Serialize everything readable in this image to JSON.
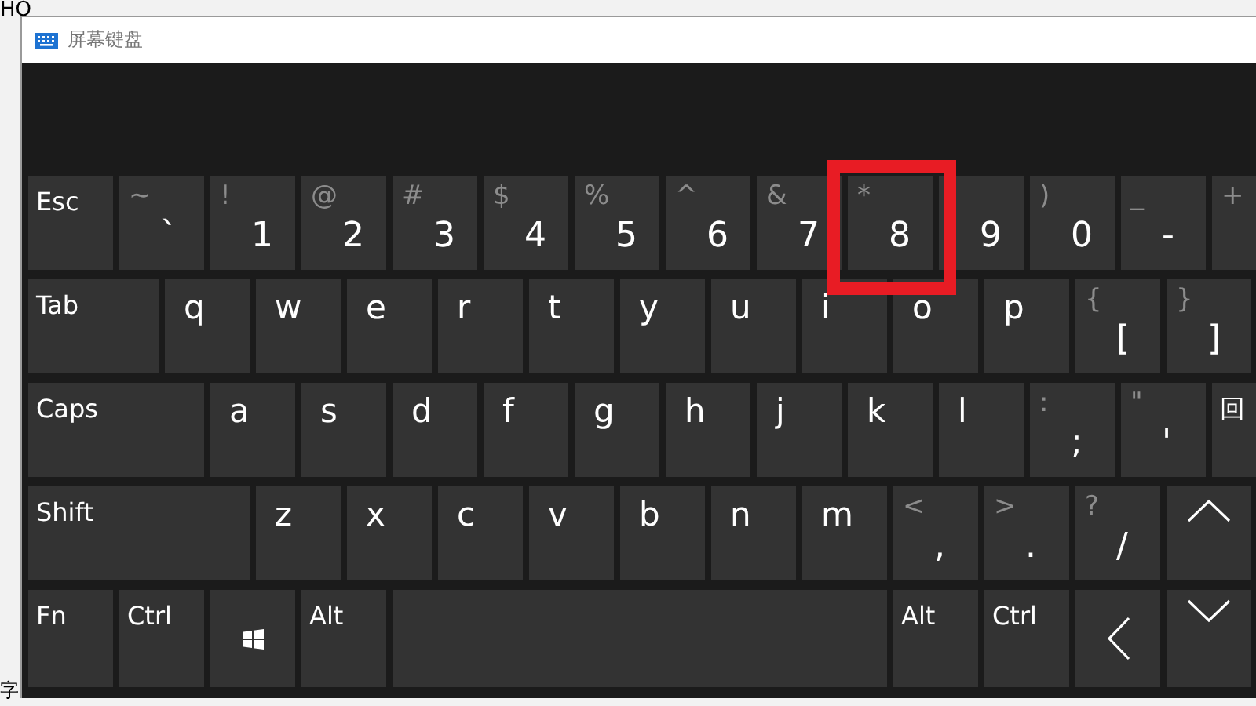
{
  "background": {
    "top_text": "HO",
    "bottom_text": "字"
  },
  "window": {
    "title": "屏幕键盘"
  },
  "rows": [
    {
      "keys": [
        {
          "kind": "label",
          "label": "Esc"
        },
        {
          "kind": "dual",
          "shift": "~",
          "main": "`"
        },
        {
          "kind": "dual",
          "shift": "!",
          "main": "1"
        },
        {
          "kind": "dual",
          "shift": "@",
          "main": "2"
        },
        {
          "kind": "dual",
          "shift": "#",
          "main": "3"
        },
        {
          "kind": "dual",
          "shift": "$",
          "main": "4"
        },
        {
          "kind": "dual",
          "shift": "%",
          "main": "5"
        },
        {
          "kind": "dual",
          "shift": "^",
          "main": "6"
        },
        {
          "kind": "dual",
          "shift": "&",
          "main": "7"
        },
        {
          "kind": "dual",
          "shift": "*",
          "main": "8",
          "highlighted": true
        },
        {
          "kind": "dual",
          "main": "9"
        },
        {
          "kind": "dual",
          "shift": ")",
          "main": "0"
        },
        {
          "kind": "dual",
          "shift": "_",
          "main": "-"
        },
        {
          "kind": "dual",
          "shift": "+"
        }
      ]
    },
    {
      "keys": [
        {
          "kind": "label",
          "label": "Tab"
        },
        {
          "kind": "char",
          "label": "q"
        },
        {
          "kind": "char",
          "label": "w"
        },
        {
          "kind": "char",
          "label": "e"
        },
        {
          "kind": "char",
          "label": "r"
        },
        {
          "kind": "char",
          "label": "t"
        },
        {
          "kind": "char",
          "label": "y"
        },
        {
          "kind": "char",
          "label": "u"
        },
        {
          "kind": "char",
          "label": "i"
        },
        {
          "kind": "char",
          "label": "o"
        },
        {
          "kind": "char",
          "label": "p"
        },
        {
          "kind": "dual",
          "shift": "{",
          "main": "["
        },
        {
          "kind": "dual",
          "shift": "}",
          "main": "]"
        }
      ]
    },
    {
      "keys": [
        {
          "kind": "label",
          "label": "Caps"
        },
        {
          "kind": "char",
          "label": "a"
        },
        {
          "kind": "char",
          "label": "s"
        },
        {
          "kind": "char",
          "label": "d"
        },
        {
          "kind": "char",
          "label": "f"
        },
        {
          "kind": "char",
          "label": "g"
        },
        {
          "kind": "char",
          "label": "h"
        },
        {
          "kind": "char",
          "label": "j"
        },
        {
          "kind": "char",
          "label": "k"
        },
        {
          "kind": "char",
          "label": "l"
        },
        {
          "kind": "dual",
          "shift": ":",
          "main": ";"
        },
        {
          "kind": "dual",
          "shift": "\"",
          "main": "'"
        },
        {
          "kind": "label",
          "label": "回"
        }
      ]
    },
    {
      "keys": [
        {
          "kind": "label",
          "label": "Shift"
        },
        {
          "kind": "char",
          "label": "z"
        },
        {
          "kind": "char",
          "label": "x"
        },
        {
          "kind": "char",
          "label": "c"
        },
        {
          "kind": "char",
          "label": "v"
        },
        {
          "kind": "char",
          "label": "b"
        },
        {
          "kind": "char",
          "label": "n"
        },
        {
          "kind": "char",
          "label": "m"
        },
        {
          "kind": "dual",
          "shift": "<",
          "main": ","
        },
        {
          "kind": "dual",
          "shift": ">",
          "main": "."
        },
        {
          "kind": "dual",
          "shift": "?",
          "main": "/"
        },
        {
          "kind": "up"
        }
      ]
    },
    {
      "keys": [
        {
          "kind": "label",
          "label": "Fn"
        },
        {
          "kind": "label",
          "label": "Ctrl"
        },
        {
          "kind": "windows"
        },
        {
          "kind": "label",
          "label": "Alt"
        },
        {
          "kind": "space"
        },
        {
          "kind": "label",
          "label": "Alt"
        },
        {
          "kind": "label",
          "label": "Ctrl"
        },
        {
          "kind": "left"
        },
        {
          "kind": "down"
        }
      ]
    }
  ]
}
